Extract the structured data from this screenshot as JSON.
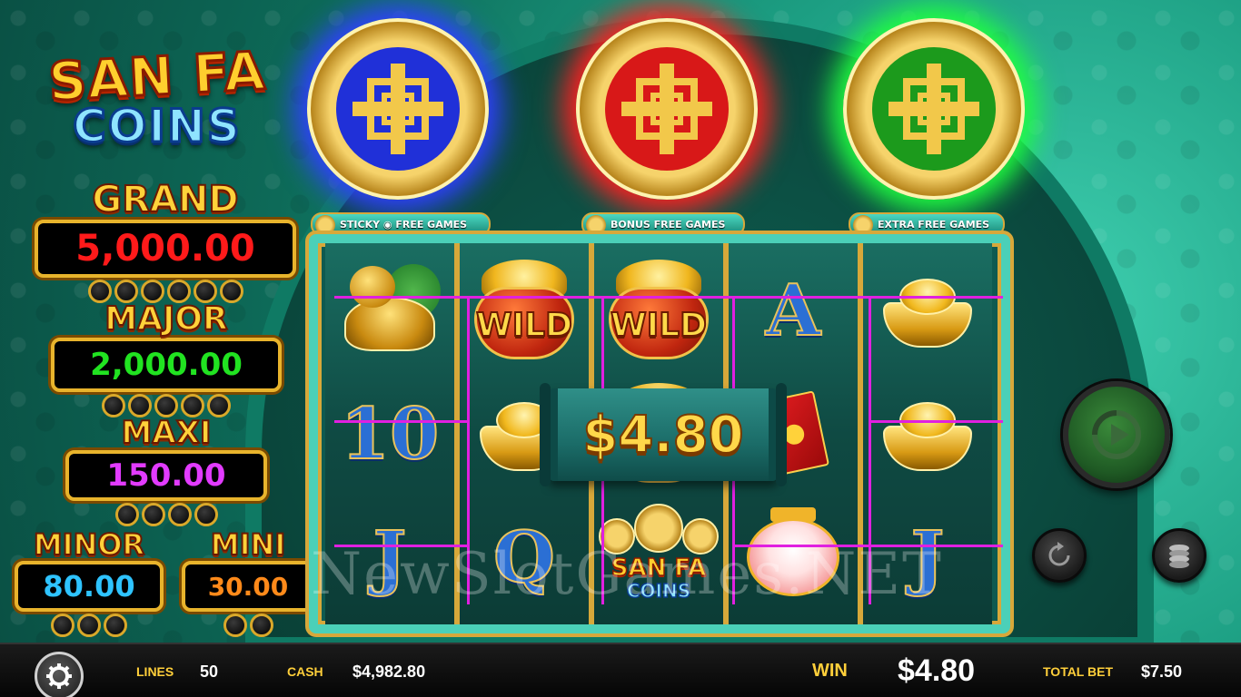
{
  "logo": {
    "line1": "SAN FA",
    "line2": "COINS"
  },
  "jackpots": [
    {
      "title": "GRAND",
      "value": "5,000.00",
      "color": "#ff1a1a"
    },
    {
      "title": "MAJOR",
      "value": "2,000.00",
      "color": "#21e321"
    },
    {
      "title": "MAXI",
      "value": "150.00",
      "color": "#e23bff"
    },
    {
      "title": "MINOR",
      "value": "80.00",
      "color": "#2ec3ff"
    },
    {
      "title": "MINI",
      "value": "30.00",
      "color": "#ff8a1a"
    }
  ],
  "coins": [
    {
      "color": "blue",
      "hex": "#2030d8",
      "glow": "#3040ff"
    },
    {
      "color": "red",
      "hex": "#d81818",
      "glow": "#ff2020"
    },
    {
      "color": "green",
      "hex": "#1c9a1c",
      "glow": "#20ff40"
    }
  ],
  "banners": [
    {
      "text": "STICKY ◉ FREE GAMES"
    },
    {
      "text": "BONUS FREE GAMES"
    },
    {
      "text": "EXTRA FREE GAMES"
    }
  ],
  "reels": {
    "symbols": [
      [
        "turtle",
        "10",
        "J"
      ],
      [
        "wild",
        "ingot",
        "Q"
      ],
      [
        "wild",
        "wild",
        "logo"
      ],
      [
        "A",
        "envelope",
        "lantern"
      ],
      [
        "ingot",
        "ingot",
        "J"
      ]
    ],
    "wild_label": "WILD",
    "letters": {
      "10": "10",
      "J": "J",
      "Q": "Q",
      "A": "A"
    },
    "mini_logo": {
      "line1": "SAN FA",
      "line2": "COINS"
    }
  },
  "win_scroll": {
    "amount": "$4.80"
  },
  "watermark": "NewSlotGames.NET",
  "bottom_bar": {
    "lines_label": "LINES",
    "lines_value": "50",
    "cash_label": "CASH",
    "cash_value": "$4,982.80",
    "win_label": "WIN",
    "win_value": "$4.80",
    "total_bet_label": "TOTAL BET",
    "total_bet_value": "$7.50"
  },
  "icons": {
    "settings": "gear-icon",
    "spin": "spin-icon",
    "autoplay": "autoplay-icon",
    "bet": "coin-stack-icon"
  }
}
